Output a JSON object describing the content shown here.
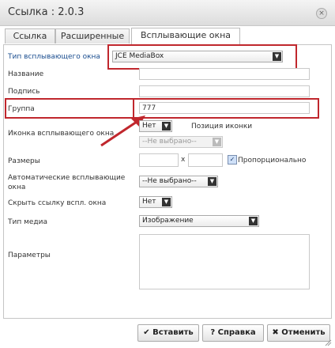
{
  "window": {
    "title": "Ссылка : 2.0.3",
    "close_glyph": "×"
  },
  "tabs": [
    {
      "label": "Ссылка"
    },
    {
      "label": "Расширенные"
    },
    {
      "label": "Всплывающие окна"
    }
  ],
  "form": {
    "popup_type": {
      "label": "Тип всплывающего окна",
      "value": "JCE MediaBox"
    },
    "name": {
      "label": "Название",
      "value": ""
    },
    "caption": {
      "label": "Подпись",
      "value": ""
    },
    "group": {
      "label": "Группа",
      "value": "777"
    },
    "popup_icon": {
      "label": "Иконка всплывающего окна",
      "value": "Нет",
      "position_label": "Позиция иконки",
      "position_value": "--Не выбрано--"
    },
    "dimensions": {
      "label": "Размеры",
      "width": "",
      "height": "",
      "separator": "x",
      "proportional_label": "Пропорционально",
      "proportional_checked": true,
      "check_glyph": "✓"
    },
    "auto_popup": {
      "label": "Автоматические всплывающие окна",
      "value": "--Не выбрано--"
    },
    "hide_link": {
      "label": "Скрыть ссылку вспл. окна",
      "value": "Нет"
    },
    "media_type": {
      "label": "Тип медиа",
      "value": "Изображение"
    },
    "params": {
      "label": "Параметры",
      "value": ""
    }
  },
  "buttons": {
    "insert": {
      "icon": "✔",
      "label": "Вставить"
    },
    "help": {
      "icon": "?",
      "label": "Справка"
    },
    "cancel": {
      "icon": "✖",
      "label": "Отменить"
    }
  },
  "colors": {
    "highlight": "#c0272d",
    "accent_label": "#1a4d8f"
  }
}
